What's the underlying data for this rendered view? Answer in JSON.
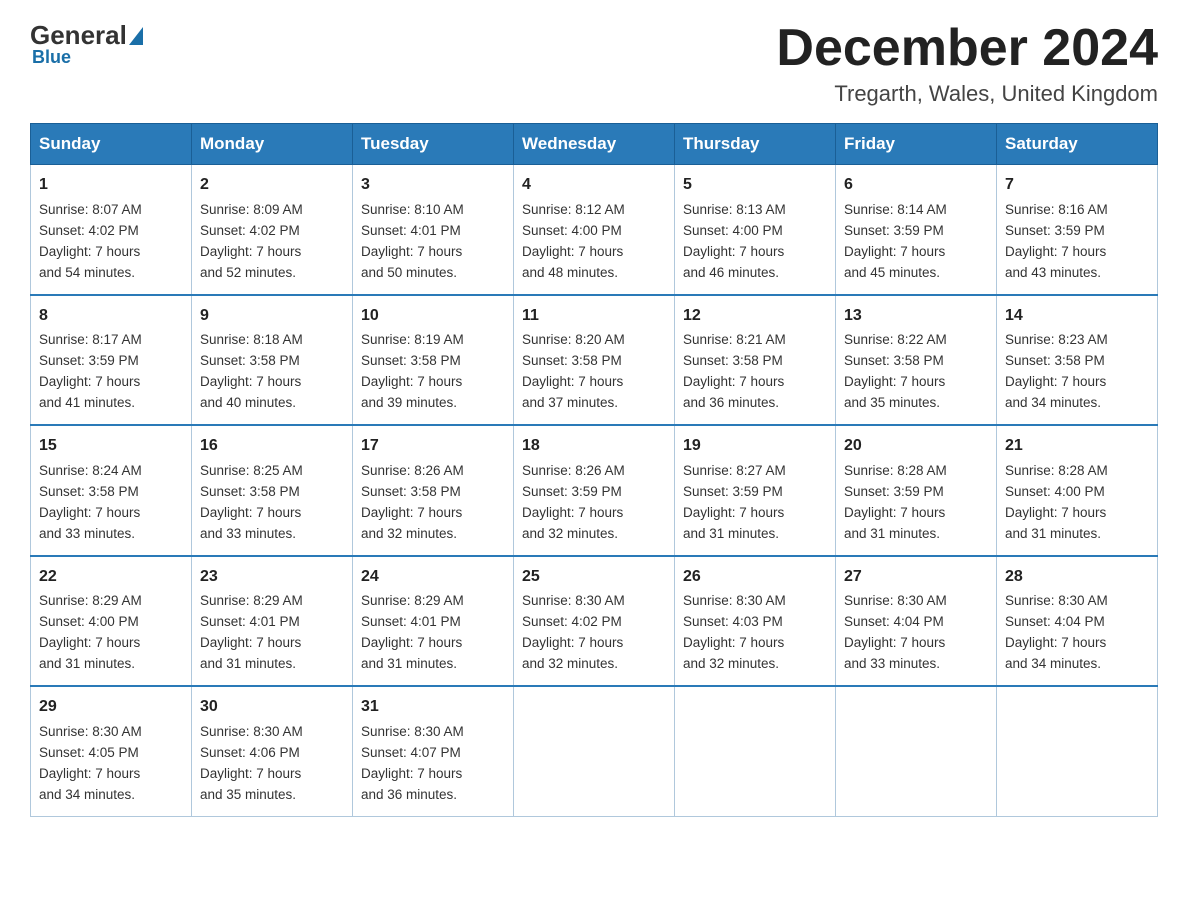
{
  "logo": {
    "general": "General",
    "blue": "Blue"
  },
  "header": {
    "month": "December 2024",
    "location": "Tregarth, Wales, United Kingdom"
  },
  "days_of_week": [
    "Sunday",
    "Monday",
    "Tuesday",
    "Wednesday",
    "Thursday",
    "Friday",
    "Saturday"
  ],
  "weeks": [
    [
      {
        "day": "1",
        "sunrise": "Sunrise: 8:07 AM",
        "sunset": "Sunset: 4:02 PM",
        "daylight": "Daylight: 7 hours",
        "daylight2": "and 54 minutes."
      },
      {
        "day": "2",
        "sunrise": "Sunrise: 8:09 AM",
        "sunset": "Sunset: 4:02 PM",
        "daylight": "Daylight: 7 hours",
        "daylight2": "and 52 minutes."
      },
      {
        "day": "3",
        "sunrise": "Sunrise: 8:10 AM",
        "sunset": "Sunset: 4:01 PM",
        "daylight": "Daylight: 7 hours",
        "daylight2": "and 50 minutes."
      },
      {
        "day": "4",
        "sunrise": "Sunrise: 8:12 AM",
        "sunset": "Sunset: 4:00 PM",
        "daylight": "Daylight: 7 hours",
        "daylight2": "and 48 minutes."
      },
      {
        "day": "5",
        "sunrise": "Sunrise: 8:13 AM",
        "sunset": "Sunset: 4:00 PM",
        "daylight": "Daylight: 7 hours",
        "daylight2": "and 46 minutes."
      },
      {
        "day": "6",
        "sunrise": "Sunrise: 8:14 AM",
        "sunset": "Sunset: 3:59 PM",
        "daylight": "Daylight: 7 hours",
        "daylight2": "and 45 minutes."
      },
      {
        "day": "7",
        "sunrise": "Sunrise: 8:16 AM",
        "sunset": "Sunset: 3:59 PM",
        "daylight": "Daylight: 7 hours",
        "daylight2": "and 43 minutes."
      }
    ],
    [
      {
        "day": "8",
        "sunrise": "Sunrise: 8:17 AM",
        "sunset": "Sunset: 3:59 PM",
        "daylight": "Daylight: 7 hours",
        "daylight2": "and 41 minutes."
      },
      {
        "day": "9",
        "sunrise": "Sunrise: 8:18 AM",
        "sunset": "Sunset: 3:58 PM",
        "daylight": "Daylight: 7 hours",
        "daylight2": "and 40 minutes."
      },
      {
        "day": "10",
        "sunrise": "Sunrise: 8:19 AM",
        "sunset": "Sunset: 3:58 PM",
        "daylight": "Daylight: 7 hours",
        "daylight2": "and 39 minutes."
      },
      {
        "day": "11",
        "sunrise": "Sunrise: 8:20 AM",
        "sunset": "Sunset: 3:58 PM",
        "daylight": "Daylight: 7 hours",
        "daylight2": "and 37 minutes."
      },
      {
        "day": "12",
        "sunrise": "Sunrise: 8:21 AM",
        "sunset": "Sunset: 3:58 PM",
        "daylight": "Daylight: 7 hours",
        "daylight2": "and 36 minutes."
      },
      {
        "day": "13",
        "sunrise": "Sunrise: 8:22 AM",
        "sunset": "Sunset: 3:58 PM",
        "daylight": "Daylight: 7 hours",
        "daylight2": "and 35 minutes."
      },
      {
        "day": "14",
        "sunrise": "Sunrise: 8:23 AM",
        "sunset": "Sunset: 3:58 PM",
        "daylight": "Daylight: 7 hours",
        "daylight2": "and 34 minutes."
      }
    ],
    [
      {
        "day": "15",
        "sunrise": "Sunrise: 8:24 AM",
        "sunset": "Sunset: 3:58 PM",
        "daylight": "Daylight: 7 hours",
        "daylight2": "and 33 minutes."
      },
      {
        "day": "16",
        "sunrise": "Sunrise: 8:25 AM",
        "sunset": "Sunset: 3:58 PM",
        "daylight": "Daylight: 7 hours",
        "daylight2": "and 33 minutes."
      },
      {
        "day": "17",
        "sunrise": "Sunrise: 8:26 AM",
        "sunset": "Sunset: 3:58 PM",
        "daylight": "Daylight: 7 hours",
        "daylight2": "and 32 minutes."
      },
      {
        "day": "18",
        "sunrise": "Sunrise: 8:26 AM",
        "sunset": "Sunset: 3:59 PM",
        "daylight": "Daylight: 7 hours",
        "daylight2": "and 32 minutes."
      },
      {
        "day": "19",
        "sunrise": "Sunrise: 8:27 AM",
        "sunset": "Sunset: 3:59 PM",
        "daylight": "Daylight: 7 hours",
        "daylight2": "and 31 minutes."
      },
      {
        "day": "20",
        "sunrise": "Sunrise: 8:28 AM",
        "sunset": "Sunset: 3:59 PM",
        "daylight": "Daylight: 7 hours",
        "daylight2": "and 31 minutes."
      },
      {
        "day": "21",
        "sunrise": "Sunrise: 8:28 AM",
        "sunset": "Sunset: 4:00 PM",
        "daylight": "Daylight: 7 hours",
        "daylight2": "and 31 minutes."
      }
    ],
    [
      {
        "day": "22",
        "sunrise": "Sunrise: 8:29 AM",
        "sunset": "Sunset: 4:00 PM",
        "daylight": "Daylight: 7 hours",
        "daylight2": "and 31 minutes."
      },
      {
        "day": "23",
        "sunrise": "Sunrise: 8:29 AM",
        "sunset": "Sunset: 4:01 PM",
        "daylight": "Daylight: 7 hours",
        "daylight2": "and 31 minutes."
      },
      {
        "day": "24",
        "sunrise": "Sunrise: 8:29 AM",
        "sunset": "Sunset: 4:01 PM",
        "daylight": "Daylight: 7 hours",
        "daylight2": "and 31 minutes."
      },
      {
        "day": "25",
        "sunrise": "Sunrise: 8:30 AM",
        "sunset": "Sunset: 4:02 PM",
        "daylight": "Daylight: 7 hours",
        "daylight2": "and 32 minutes."
      },
      {
        "day": "26",
        "sunrise": "Sunrise: 8:30 AM",
        "sunset": "Sunset: 4:03 PM",
        "daylight": "Daylight: 7 hours",
        "daylight2": "and 32 minutes."
      },
      {
        "day": "27",
        "sunrise": "Sunrise: 8:30 AM",
        "sunset": "Sunset: 4:04 PM",
        "daylight": "Daylight: 7 hours",
        "daylight2": "and 33 minutes."
      },
      {
        "day": "28",
        "sunrise": "Sunrise: 8:30 AM",
        "sunset": "Sunset: 4:04 PM",
        "daylight": "Daylight: 7 hours",
        "daylight2": "and 34 minutes."
      }
    ],
    [
      {
        "day": "29",
        "sunrise": "Sunrise: 8:30 AM",
        "sunset": "Sunset: 4:05 PM",
        "daylight": "Daylight: 7 hours",
        "daylight2": "and 34 minutes."
      },
      {
        "day": "30",
        "sunrise": "Sunrise: 8:30 AM",
        "sunset": "Sunset: 4:06 PM",
        "daylight": "Daylight: 7 hours",
        "daylight2": "and 35 minutes."
      },
      {
        "day": "31",
        "sunrise": "Sunrise: 8:30 AM",
        "sunset": "Sunset: 4:07 PM",
        "daylight": "Daylight: 7 hours",
        "daylight2": "and 36 minutes."
      },
      null,
      null,
      null,
      null
    ]
  ]
}
